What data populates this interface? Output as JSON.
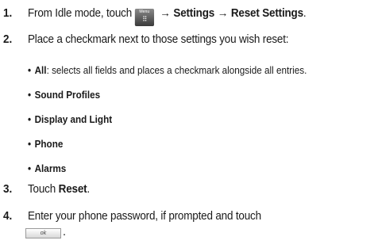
{
  "steps": [
    {
      "number": "1.",
      "text_before": "From Idle mode, touch",
      "menu_key_label": "Menu",
      "menu_key_glyph": "⠿",
      "arrow": "→",
      "item1": "Settings",
      "item2": "Reset Settings",
      "end": "."
    },
    {
      "number": "2.",
      "text": "Place a checkmark next to those settings you wish reset:"
    },
    {
      "number": "3.",
      "text_before": "Touch",
      "bold": "Reset",
      "end": "."
    },
    {
      "number": "4.",
      "line1": "Enter your phone password, if prompted and touch",
      "ok_label": "ok",
      "end": "."
    }
  ],
  "bullets": [
    {
      "marker": "•",
      "label": "All",
      "desc": ": selects all fields and places a checkmark alongside all entries."
    },
    {
      "marker": "•",
      "label": "Sound Profiles"
    },
    {
      "marker": "•",
      "label": "Display and Light"
    },
    {
      "marker": "•",
      "label": "Phone"
    },
    {
      "marker": "•",
      "label": "Alarms"
    }
  ]
}
